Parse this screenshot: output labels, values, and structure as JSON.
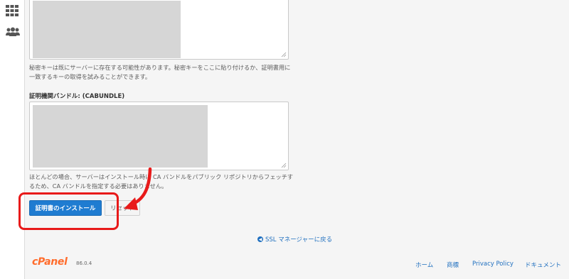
{
  "sidebar": {
    "icons": [
      "grid-icon",
      "users-icon"
    ]
  },
  "private_key": {
    "help": "秘密キーは既にサーバーに存在する可能性があります。秘密キーをここに貼り付けるか、証明書用に一致するキーの取得を試みることができます。"
  },
  "cabundle": {
    "label": "証明機関バンドル: (CABUNDLE)",
    "help": "ほとんどの場合、サーバーはインストール時に CA バンドルをパブリック リポジトリからフェッチするため、CA バンドルを指定する必要はありません。"
  },
  "buttons": {
    "install_label": "証明書のインストール",
    "reset_label": "リセット"
  },
  "back_link": {
    "label": "SSL マネージャーに戻る"
  },
  "footer": {
    "logo": "cPanel",
    "version": "86.0.4",
    "links": [
      "ホーム",
      "商標",
      "Privacy Policy",
      "ドキュメント"
    ]
  },
  "colors": {
    "primary": "#1f7cd1",
    "link": "#1f6fbf",
    "annotation_red": "#e81a1a",
    "brand_orange": "#ff6c2c"
  }
}
